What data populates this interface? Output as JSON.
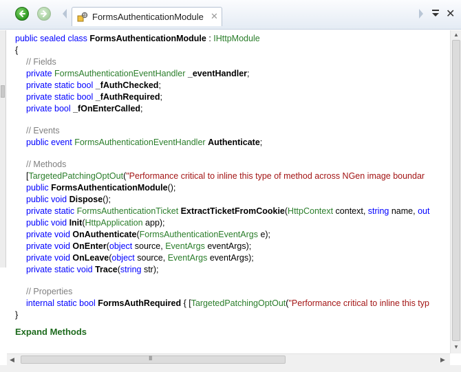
{
  "toolbar": {
    "tab_label": "FormsAuthenticationModule",
    "tab_close_glyph": "✕",
    "close_glyph": "✕"
  },
  "colors": {
    "keyword": "#0000ff",
    "type": "#2b91af",
    "comment": "#7f7f7f",
    "string": "#a31515",
    "link": "#1e6b1e"
  },
  "code": {
    "class_decl": {
      "mods": "public sealed class",
      "name": "FormsAuthenticationModule",
      "colon": " : ",
      "base": "IHttpModule"
    },
    "open_brace": "{",
    "close_brace": "}",
    "fields_comment": "// Fields",
    "fields": [
      {
        "mods": "private",
        "type": "FormsAuthenticationEventHandler",
        "name": "_eventHandler",
        "end": ";"
      },
      {
        "mods": "private static bool",
        "type": "",
        "name": "_fAuthChecked",
        "end": ";"
      },
      {
        "mods": "private static bool",
        "type": "",
        "name": "_fAuthRequired",
        "end": ";"
      },
      {
        "mods": "private bool",
        "type": "",
        "name": "_fOnEnterCalled",
        "end": ";"
      }
    ],
    "events_comment": "// Events",
    "event": {
      "mods": "public event",
      "type": "FormsAuthenticationEventHandler",
      "name": "Authenticate",
      "end": ";"
    },
    "methods_comment": "// Methods",
    "methods": {
      "attr_open": "[",
      "attr_name": "TargetedPatchingOptOut",
      "attr_paren": "(",
      "attr_string": "\"Performance critical to inline this type of method across NGen image boundar",
      "ctor": {
        "mods": "public",
        "name": "FormsAuthenticationModule",
        "end": "();"
      },
      "dispose": {
        "mods": "public void",
        "name": "Dispose",
        "end": "();"
      },
      "extract": {
        "mods": "private static",
        "ret": "FormsAuthenticationTicket",
        "name": "ExtractTicketFromCookie",
        "p1type": "HttpContext",
        "p1": " context, ",
        "p2type": "string",
        "p2": " name, ",
        "p3": "out"
      },
      "init": {
        "mods": "public void",
        "name": "Init",
        "ptype": "HttpApplication",
        "pname": " app);"
      },
      "onauth": {
        "mods": "private void",
        "name": "OnAuthenticate",
        "ptype": "FormsAuthenticationEventArgs",
        "pname": " e);"
      },
      "onenter": {
        "mods": "private void",
        "name": "OnEnter",
        "p1type": "object",
        "p1": " source, ",
        "p2type": "EventArgs",
        "p2": " eventArgs);"
      },
      "onleave": {
        "mods": "private void",
        "name": "OnLeave",
        "p1type": "object",
        "p1": " source, ",
        "p2type": "EventArgs",
        "p2": " eventArgs);"
      },
      "trace": {
        "mods": "private static void",
        "name": "Trace",
        "ptype": "string",
        "pname": " str);"
      }
    },
    "properties_comment": "// Properties",
    "property": {
      "mods": "internal static bool",
      "name": "FormsAuthRequired",
      "brace": " { [",
      "attr_name": "TargetedPatchingOptOut",
      "attr_paren": "(",
      "attr_string": "\"Performance critical to inline this typ"
    },
    "expand_link": "Expand Methods"
  },
  "scroll": {
    "grip": "III"
  }
}
